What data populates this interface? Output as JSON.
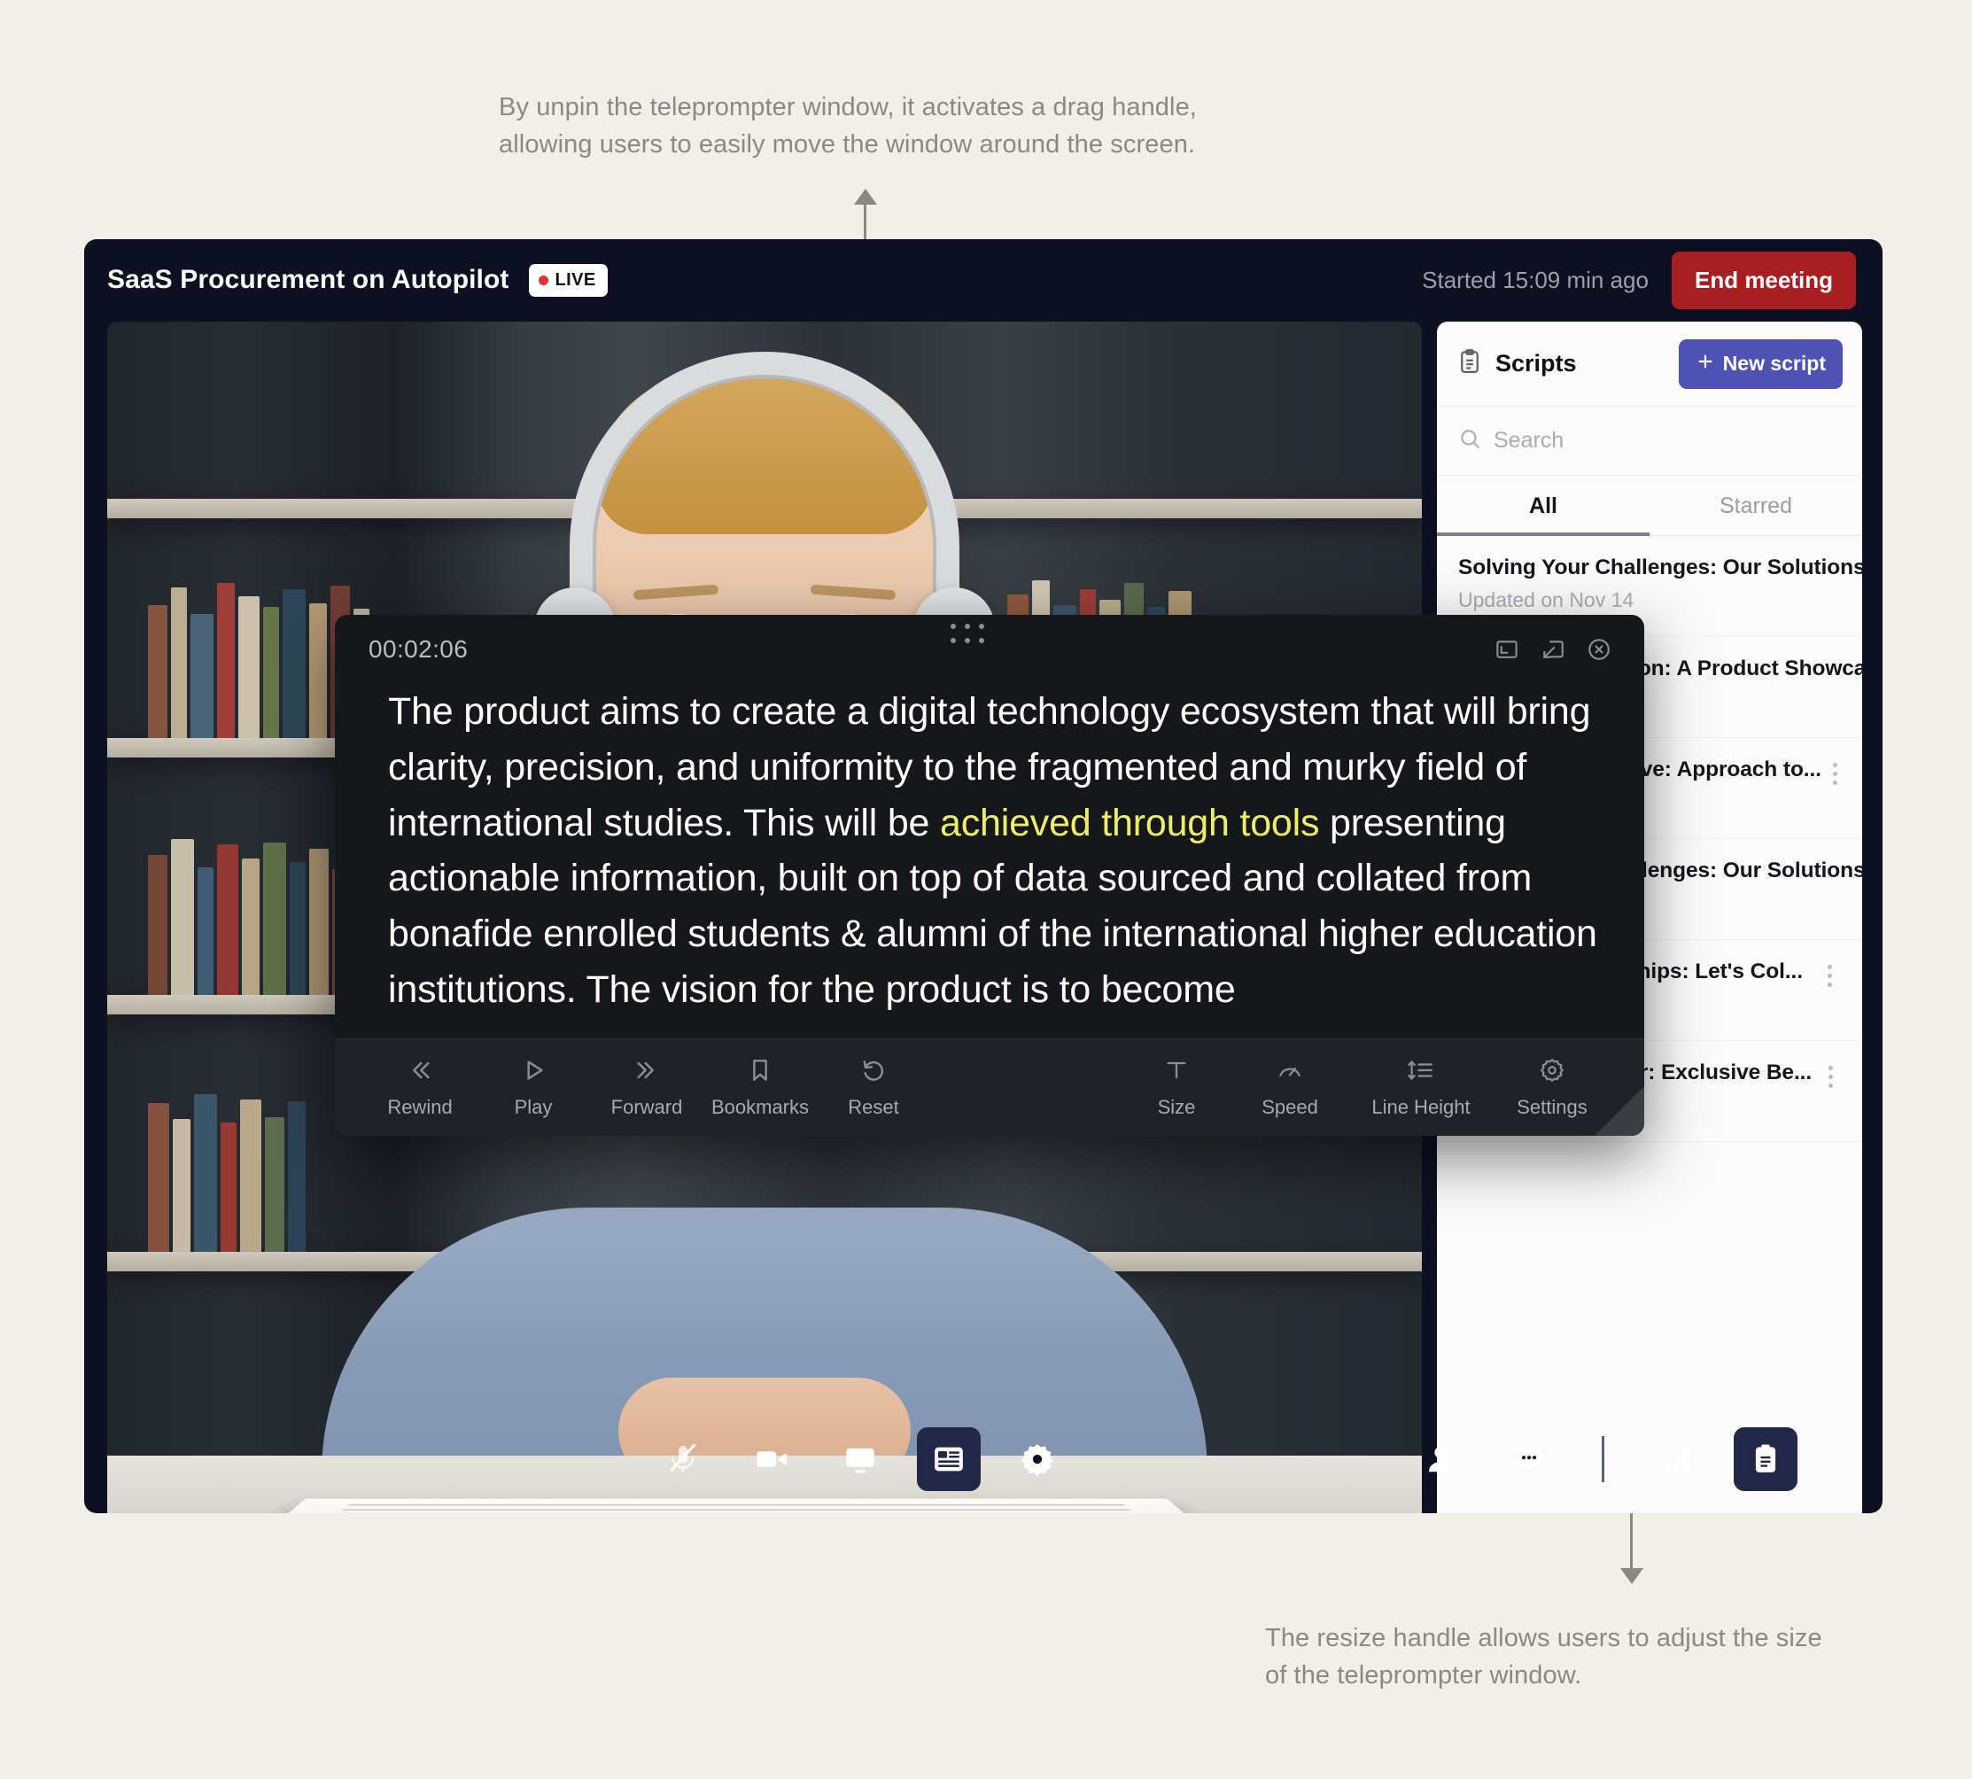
{
  "annotations": {
    "top": "By unpin the teleprompter window, it activates a drag handle,\nallowing users to easily move the window around the screen.",
    "bottom": "The resize handle allows users to adjust the size\nof the teleprompter window."
  },
  "header": {
    "title": "SaaS Procurement on Autopilot",
    "live_label": "LIVE",
    "started_text": "Started 15:09 min ago",
    "end_meeting_label": "End meeting"
  },
  "scripts_panel": {
    "title": "Scripts",
    "new_script_label": "New script",
    "search_placeholder": "Search",
    "search_value": "",
    "tabs": [
      {
        "label": "All",
        "active": true
      },
      {
        "label": "Starred",
        "active": false
      }
    ],
    "items": [
      {
        "title": "Solving Your Challenges: Our Solutions",
        "subtitle": "Updated on Nov 14"
      },
      {
        "title": "Innovation in Action: A Product Showcase",
        "subtitle": ""
      },
      {
        "title": "A Fresh Perspective: Approach to...",
        "subtitle": ""
      },
      {
        "title": "Solving Your Challenges: Our Solutions",
        "subtitle": ""
      },
      {
        "title": "Building Partnerships: Let's Col...",
        "subtitle": ""
      },
      {
        "title": "Limited Time Offer: Exclusive Be...",
        "subtitle": ""
      }
    ]
  },
  "teleprompter": {
    "timer": "00:02:06",
    "script_before": "The product aims to create a digital technology ecosystem that will bring clarity, precision, and uniformity to the fragmented and murky field of international studies. This will be ",
    "script_highlight": "achieved through tools",
    "script_after": " presenting actionable information, built on top of data sourced and collated from bonafide enrolled students & alumni of the international higher education institutions. The vision for the product is to become",
    "window_actions": [
      {
        "name": "expand-icon"
      },
      {
        "name": "collapse-icon"
      },
      {
        "name": "close-icon"
      }
    ],
    "controls_left": [
      {
        "label": "Rewind",
        "icon": "rewind-icon"
      },
      {
        "label": "Play",
        "icon": "play-icon"
      },
      {
        "label": "Forward",
        "icon": "forward-icon"
      },
      {
        "label": "Bookmarks",
        "icon": "bookmark-icon"
      },
      {
        "label": "Reset",
        "icon": "reset-icon"
      }
    ],
    "controls_right": [
      {
        "label": "Size",
        "icon": "text-size-icon"
      },
      {
        "label": "Speed",
        "icon": "speed-icon"
      },
      {
        "label": "Line Height",
        "icon": "line-height-icon"
      },
      {
        "label": "Settings",
        "icon": "gear-icon"
      }
    ]
  },
  "bottom_toolbar": {
    "center": [
      {
        "name": "microphone-muted-icon",
        "active": false
      },
      {
        "name": "video-camera-icon",
        "active": false
      },
      {
        "name": "screen-share-icon",
        "active": false
      },
      {
        "name": "teleprompter-icon",
        "active": true
      },
      {
        "name": "gear-icon",
        "active": false
      }
    ],
    "right": [
      {
        "name": "participants-icon",
        "active": false
      },
      {
        "name": "chat-icon",
        "active": false
      },
      {
        "name": "analytics-icon",
        "active": false
      },
      {
        "name": "scripts-icon",
        "active": true
      }
    ]
  },
  "colors": {
    "page_background": "#f0efe8",
    "window_background": "#0d1020",
    "accent_indigo": "#4f52b5",
    "end_meeting_red": "#a81f23",
    "live_red": "#e0322f",
    "highlight_yellow": "#eeee66",
    "annotation_gray": "#8c897f"
  }
}
